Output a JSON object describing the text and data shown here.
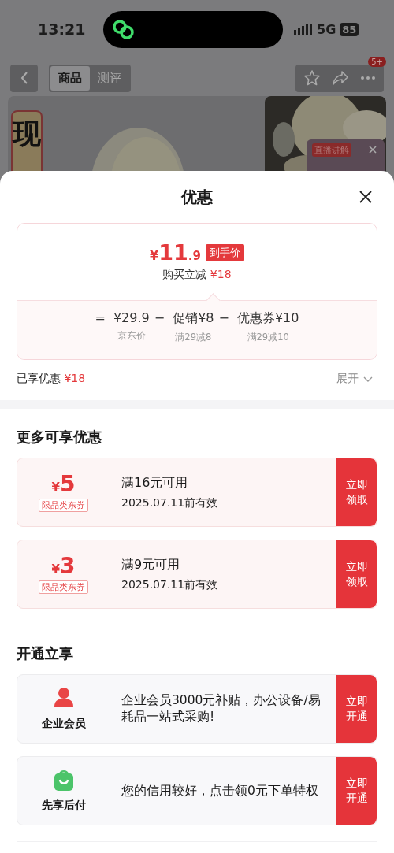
{
  "status_bar": {
    "time": "13:21",
    "network": "5G",
    "battery": "85"
  },
  "nav": {
    "tabs": [
      {
        "label": "商品",
        "selected": true
      },
      {
        "label": "测评",
        "selected": false
      }
    ],
    "badge": "5+"
  },
  "product": {
    "label": "现",
    "live_badge": "直播讲解"
  },
  "sheet": {
    "title": "优惠",
    "price_card": {
      "price": {
        "symbol": "¥",
        "whole": "11",
        "fraction": ".9"
      },
      "price_tag": "到手价",
      "saving_label": "购买立减",
      "saving_value": "¥18",
      "breakdown": [
        {
          "op": "=",
          "value": "¥29.9",
          "note": "京东价"
        },
        {
          "op": "−",
          "value": "促销¥8",
          "note": "满29减8"
        },
        {
          "op": "−",
          "value": "优惠券¥10",
          "note": "满29减10"
        }
      ]
    },
    "enjoyed": {
      "label": "已享优惠",
      "value": "¥18",
      "toggle": "展开"
    },
    "coupons_title": "更多可享优惠",
    "coupons": [
      {
        "symbol": "¥",
        "amount": "5",
        "tag": "限品类东券",
        "condition": "满16元可用",
        "validity": "2025.07.11前有效",
        "button": "立即领取"
      },
      {
        "symbol": "¥",
        "amount": "3",
        "tag": "限品类东券",
        "condition": "满9元可用",
        "validity": "2025.07.11前有效",
        "button": "立即领取"
      }
    ],
    "services_title": "开通立享",
    "services": [
      {
        "kind": "person",
        "label": "企业会员",
        "description": "企业会员3000元补贴，办公设备/易耗品一站式采购!",
        "button": "立即开通"
      },
      {
        "kind": "bag",
        "label": "先享后付",
        "description": "您的信用较好，点击领0元下单特权",
        "button": "立即开通"
      }
    ]
  }
}
